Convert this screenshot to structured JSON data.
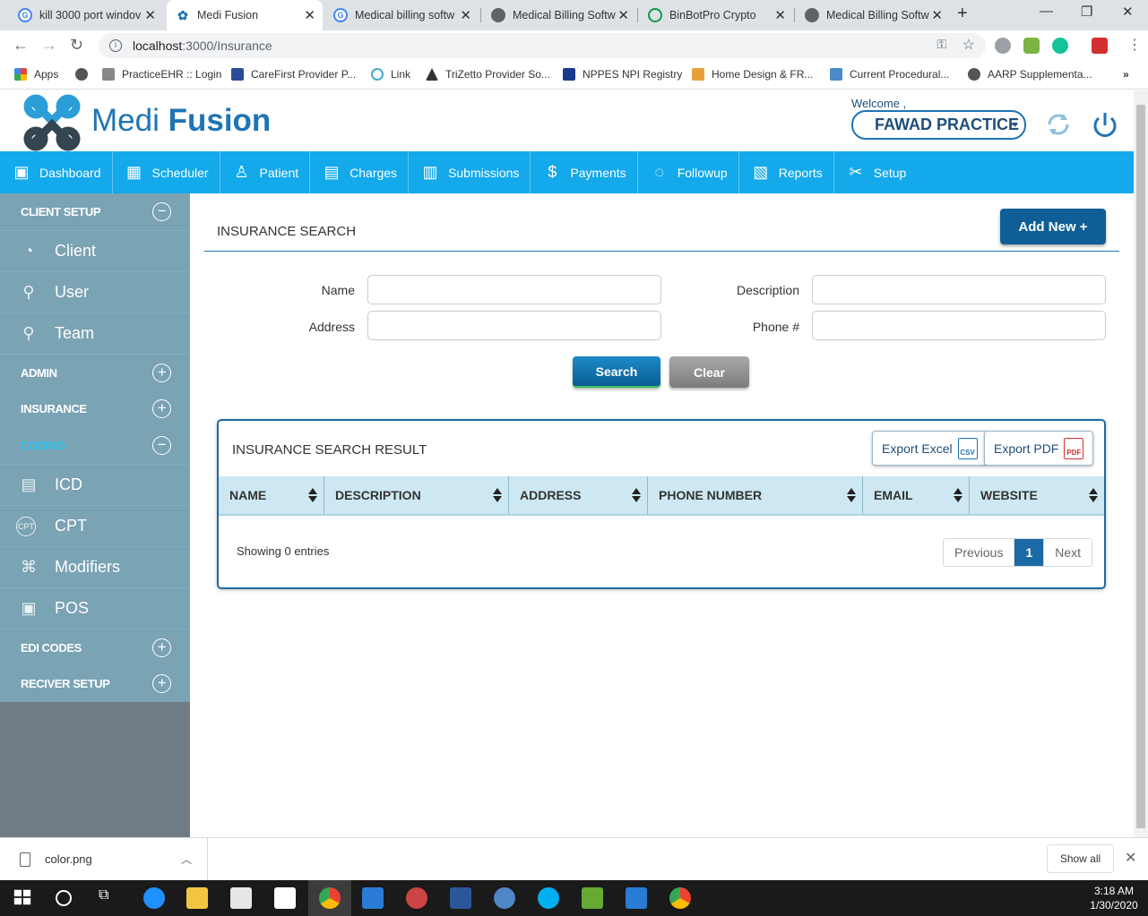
{
  "browser": {
    "tabs": [
      {
        "title": "kill 3000 port windov",
        "icon": "google-icon"
      },
      {
        "title": "Medi Fusion",
        "icon": "medifusion-icon",
        "active": true
      },
      {
        "title": "Medical billing softw",
        "icon": "google-icon"
      },
      {
        "title": "Medical Billing Softw",
        "icon": "globe-icon"
      },
      {
        "title": "BinBotPro Crypto",
        "icon": "binbot-icon"
      },
      {
        "title": "Medical Billing Softw",
        "icon": "globe-icon"
      }
    ],
    "url_host": "localhost",
    "url_rest": ":3000/Insurance",
    "bookmarks": [
      {
        "label": "Apps"
      },
      {
        "label": ""
      },
      {
        "label": "PracticeEHR :: Login"
      },
      {
        "label": "CareFirst Provider P..."
      },
      {
        "label": "Link"
      },
      {
        "label": "TriZetto Provider So..."
      },
      {
        "label": "NPPES NPI Registry"
      },
      {
        "label": "Home Design & FR..."
      },
      {
        "label": "Current Procedural..."
      },
      {
        "label": "AARP Supplementa..."
      }
    ],
    "bookmarks_more": "»"
  },
  "header": {
    "logo_text_light": "Medi ",
    "logo_text_bold": "Fusion",
    "welcome": "Welcome ,",
    "practice": "FAWAD PRACTICE"
  },
  "nav": [
    {
      "label": "Dashboard",
      "icon": "dashboard-icon"
    },
    {
      "label": "Scheduler",
      "icon": "calendar-icon"
    },
    {
      "label": "Patient",
      "icon": "patient-icon"
    },
    {
      "label": "Charges",
      "icon": "document-icon"
    },
    {
      "label": "Submissions",
      "icon": "submission-icon"
    },
    {
      "label": "Payments",
      "icon": "money-icon"
    },
    {
      "label": "Followup",
      "icon": "followup-icon"
    },
    {
      "label": "Reports",
      "icon": "report-icon"
    },
    {
      "label": "Setup",
      "icon": "tools-icon"
    }
  ],
  "sidebar": {
    "client_setup": "CLIENT SETUP",
    "client": "Client",
    "user": "User",
    "team": "Team",
    "admin": "ADMIN",
    "insurance": "INSURANCE",
    "coding": "CODING",
    "icd": "ICD",
    "cpt": "CPT",
    "modifiers": "Modifiers",
    "pos": "POS",
    "edi_codes": "EDI CODES",
    "reciver_setup": "RECIVER SETUP"
  },
  "main": {
    "title": "INSURANCE SEARCH",
    "add_new": "Add New +",
    "labels": {
      "name": "Name",
      "description": "Description",
      "address": "Address",
      "phone": "Phone #"
    },
    "values": {
      "name": "",
      "description": "",
      "address": "",
      "phone": ""
    },
    "search": "Search",
    "clear": "Clear"
  },
  "results": {
    "title": "INSURANCE SEARCH RESULT",
    "export_excel": "Export Excel",
    "export_pdf": "Export PDF",
    "csv_badge": "CSV",
    "pdf_badge": "PDF",
    "columns": [
      "NAME",
      "DESCRIPTION",
      "ADDRESS",
      "PHONE NUMBER",
      "EMAIL",
      "WEBSITE"
    ],
    "rows": [],
    "showing": "Showing 0 entries",
    "previous": "Previous",
    "current_page": "1",
    "next": "Next"
  },
  "downloads": {
    "file": "color.png",
    "show_all": "Show all"
  },
  "taskbar": {
    "time": "3:18 AM",
    "date": "1/30/2020"
  },
  "colors": {
    "nav_blue": "#13a9eb",
    "brand_blue": "#1f74b5",
    "sidebar": "#7aa3b4",
    "table_header": "#cde8f2",
    "add_new_bg": "#0f5f96"
  }
}
